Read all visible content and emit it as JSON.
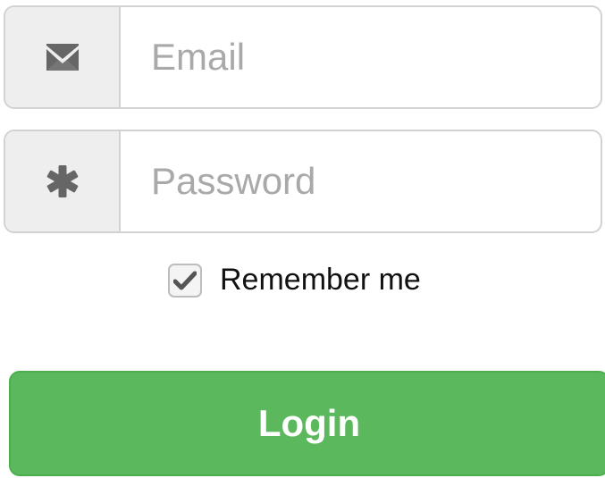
{
  "form": {
    "email": {
      "icon": "envelope-icon",
      "placeholder": "Email",
      "value": ""
    },
    "password": {
      "icon": "asterisk-icon",
      "placeholder": "Password",
      "value": ""
    },
    "remember": {
      "label": "Remember me",
      "checked": true,
      "icon": "checkmark-icon"
    },
    "login_label": "Login"
  },
  "colors": {
    "button_bg": "#5cb85c",
    "button_border": "#4cae4c",
    "addon_bg": "#eeeeee",
    "border": "#d2d2d2",
    "icon": "#666666",
    "placeholder": "#a9a9a9"
  }
}
